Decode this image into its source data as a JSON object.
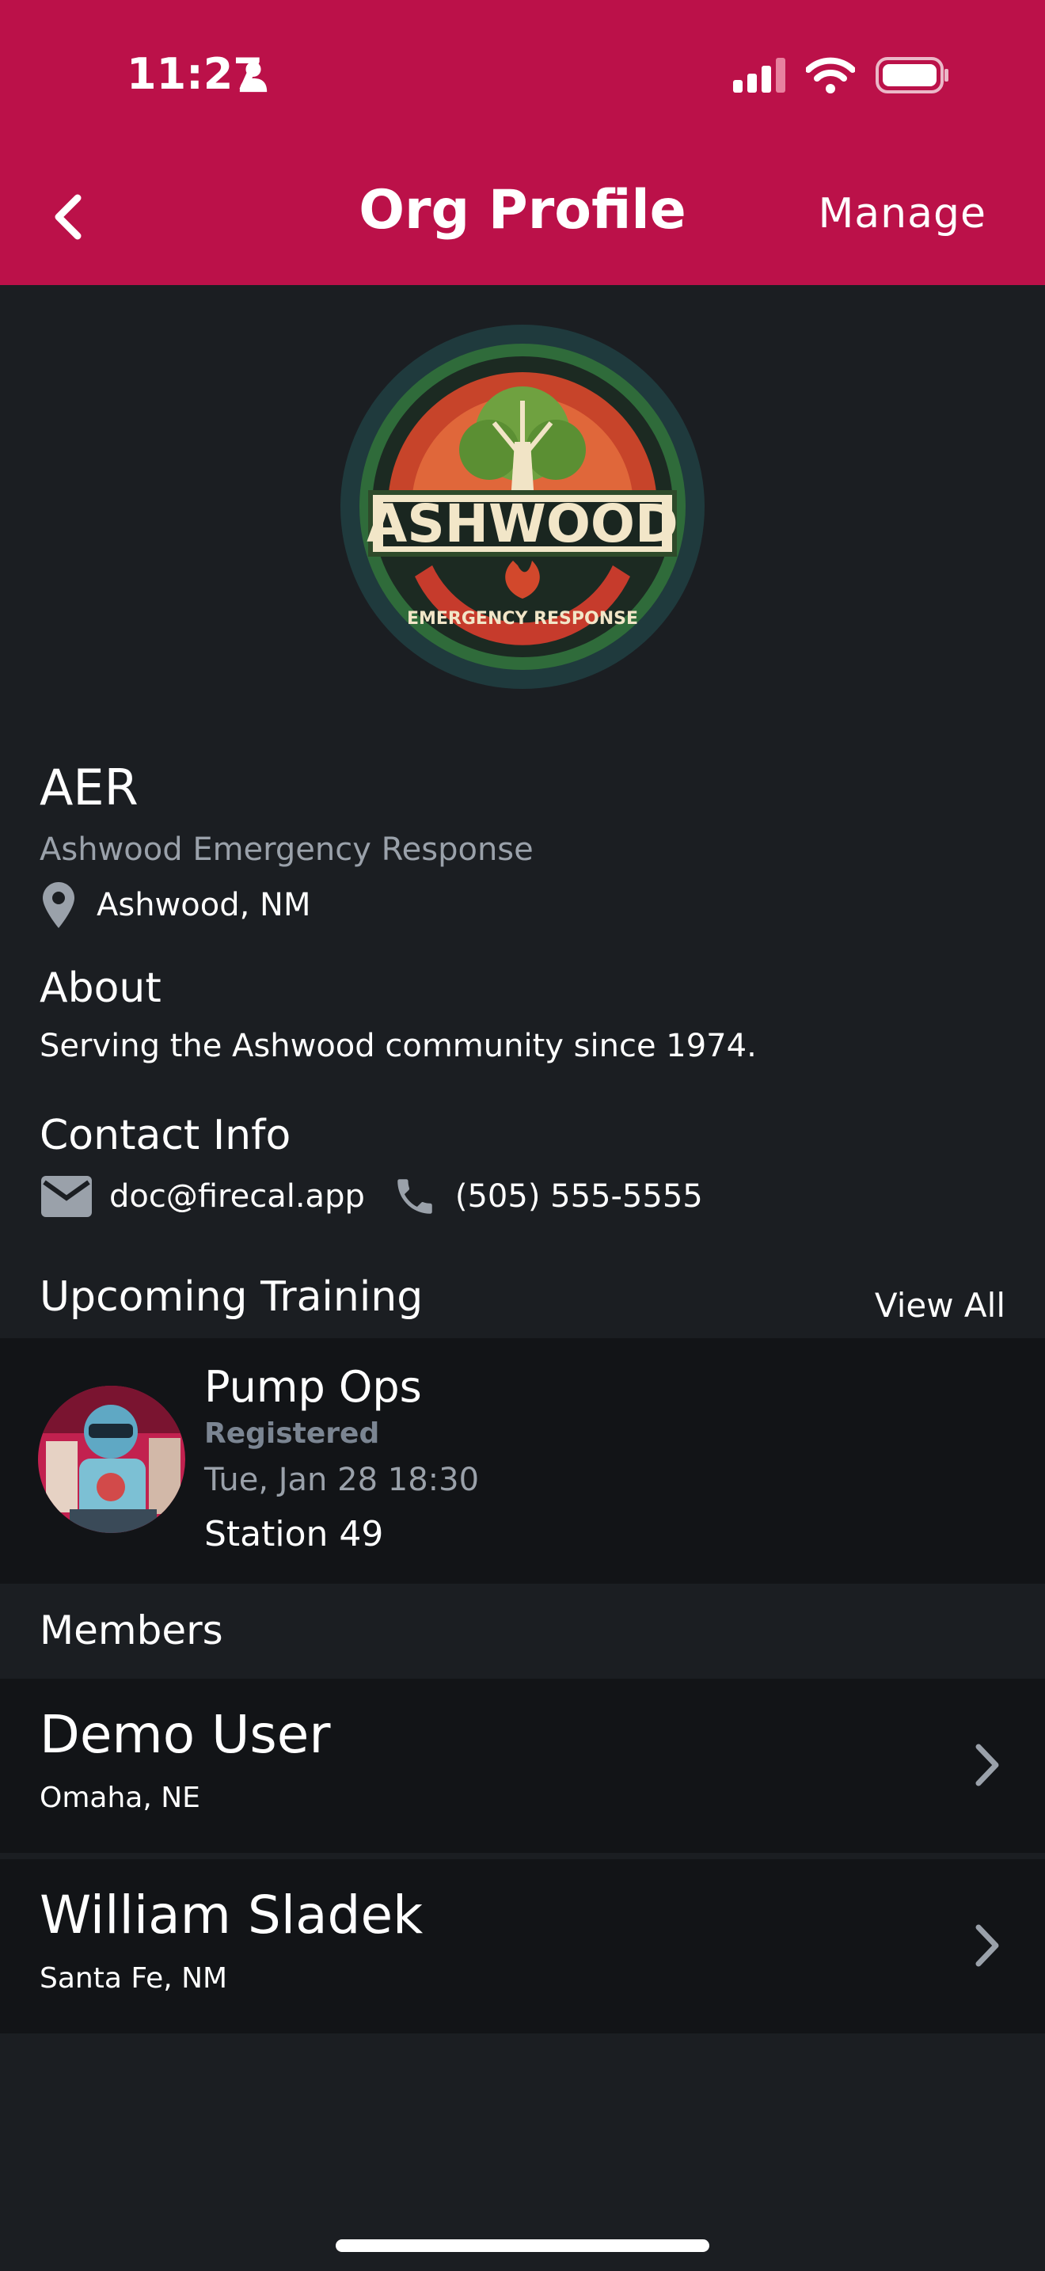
{
  "status_bar": {
    "time": "11:27"
  },
  "nav": {
    "title": "Org Profile",
    "manage_label": "Manage"
  },
  "org": {
    "abbreviation": "AER",
    "full_name": "Ashwood Emergency Response",
    "location": "Ashwood, NM",
    "logo": {
      "wordmark": "ASHWOOD",
      "subtitle": "EMERGENCY RESPONSE"
    }
  },
  "about": {
    "title": "About",
    "text": "Serving the Ashwood community since 1974."
  },
  "contact": {
    "title": "Contact Info",
    "email": "doc@firecal.app",
    "phone": "(505) 555-5555"
  },
  "training": {
    "title": "Upcoming Training",
    "view_all_label": "View All",
    "items": [
      {
        "title": "Pump Ops",
        "status": "Registered",
        "datetime": "Tue, Jan 28 18:30",
        "location": "Station 49"
      }
    ]
  },
  "members": {
    "title": "Members",
    "items": [
      {
        "name": "Demo User",
        "location": "Omaha, NE"
      },
      {
        "name": "William Sladek",
        "location": "Santa Fe, NM"
      }
    ]
  },
  "colors": {
    "header": "#bb1149",
    "background": "#1b1e22",
    "card": "#121417",
    "muted_text": "#9aa1aa"
  }
}
